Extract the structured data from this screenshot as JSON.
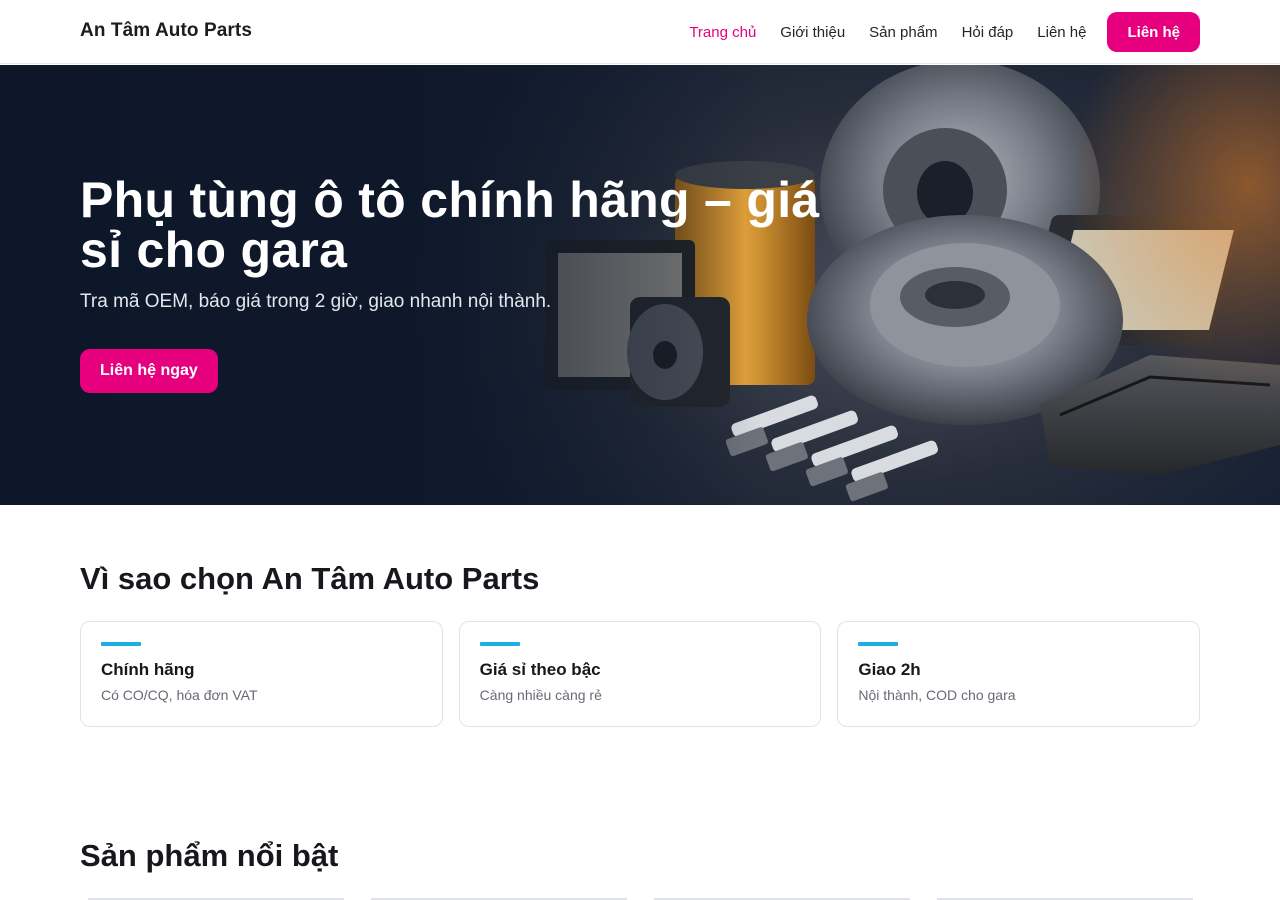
{
  "header": {
    "brand": "An Tâm Auto Parts",
    "nav": [
      {
        "label": "Trang chủ",
        "active": true
      },
      {
        "label": "Giới thiệu",
        "active": false
      },
      {
        "label": "Sản phẩm",
        "active": false
      },
      {
        "label": "Hỏi đáp",
        "active": false
      },
      {
        "label": "Liên hệ",
        "active": false
      }
    ],
    "cta_label": "Liên hệ"
  },
  "hero": {
    "title": "Phụ tùng ô tô chính hãng – giá sỉ cho gara",
    "subtitle": "Tra mã OEM, báo giá trong 2 giờ, giao nhanh nội thành.",
    "button_label": "Liên hệ ngay",
    "image_icon": "auto-parts-photo"
  },
  "why": {
    "title": "Vì sao chọn An Tâm Auto Parts",
    "cards": [
      {
        "title": "Chính hãng",
        "text": "Có CO/CQ, hóa đơn VAT"
      },
      {
        "title": "Giá sỉ theo bậc",
        "text": "Càng nhiều càng rẻ"
      },
      {
        "title": "Giao 2h",
        "text": "Nội thành, COD cho gara"
      }
    ]
  },
  "featured": {
    "title": "Sản phẩm nổi bật"
  },
  "colors": {
    "accent": "#e6007e",
    "card_bar": "#1eaee6",
    "hero_bg": "#152238"
  }
}
